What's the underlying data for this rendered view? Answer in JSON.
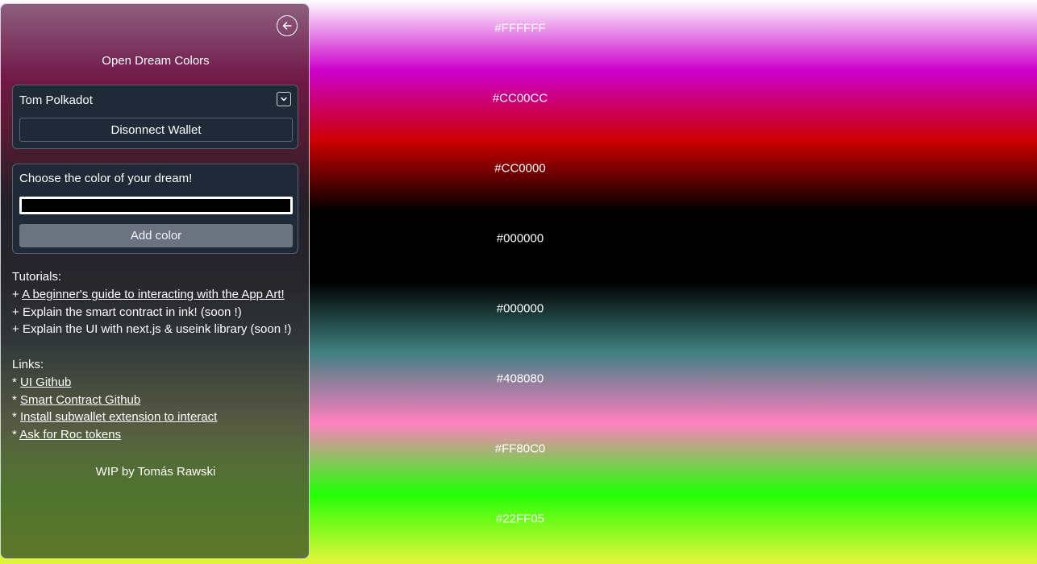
{
  "app": {
    "title": "Open Dream Colors"
  },
  "wallet": {
    "account_name": "Tom Polkadot",
    "disconnect_label": "Disonnect Wallet"
  },
  "color_form": {
    "prompt": "Choose the color of your dream!",
    "input_value": "",
    "add_label": "Add color"
  },
  "tutorials": {
    "heading": "Tutorials:",
    "items": [
      {
        "prefix": "+ ",
        "text": "A beginner's guide to interacting with the App Art!",
        "link": true
      },
      {
        "prefix": "+ ",
        "text": "Explain the smart contract in ink! (soon !)",
        "link": false
      },
      {
        "prefix": "+ ",
        "text": "Explain the UI with next.js & useink library (soon !)",
        "link": false
      }
    ]
  },
  "links": {
    "heading": "Links:",
    "items": [
      {
        "prefix": "* ",
        "text": "UI Github"
      },
      {
        "prefix": "* ",
        "text": "Smart Contract Github"
      },
      {
        "prefix": "* ",
        "text": "Install subwallet extension to interact"
      },
      {
        "prefix": "* ",
        "text": "Ask for Roc tokens"
      }
    ]
  },
  "footer": {
    "text": "WIP by Tomás Rawski"
  },
  "colors": [
    "#FFFFFF",
    "#CC00CC",
    "#CC0000",
    "#000000",
    "#000000",
    "#408080",
    "#FF80C0",
    "#22FF05"
  ],
  "icons": {
    "back": "arrow-left-icon",
    "dropdown": "chevron-down-icon"
  }
}
